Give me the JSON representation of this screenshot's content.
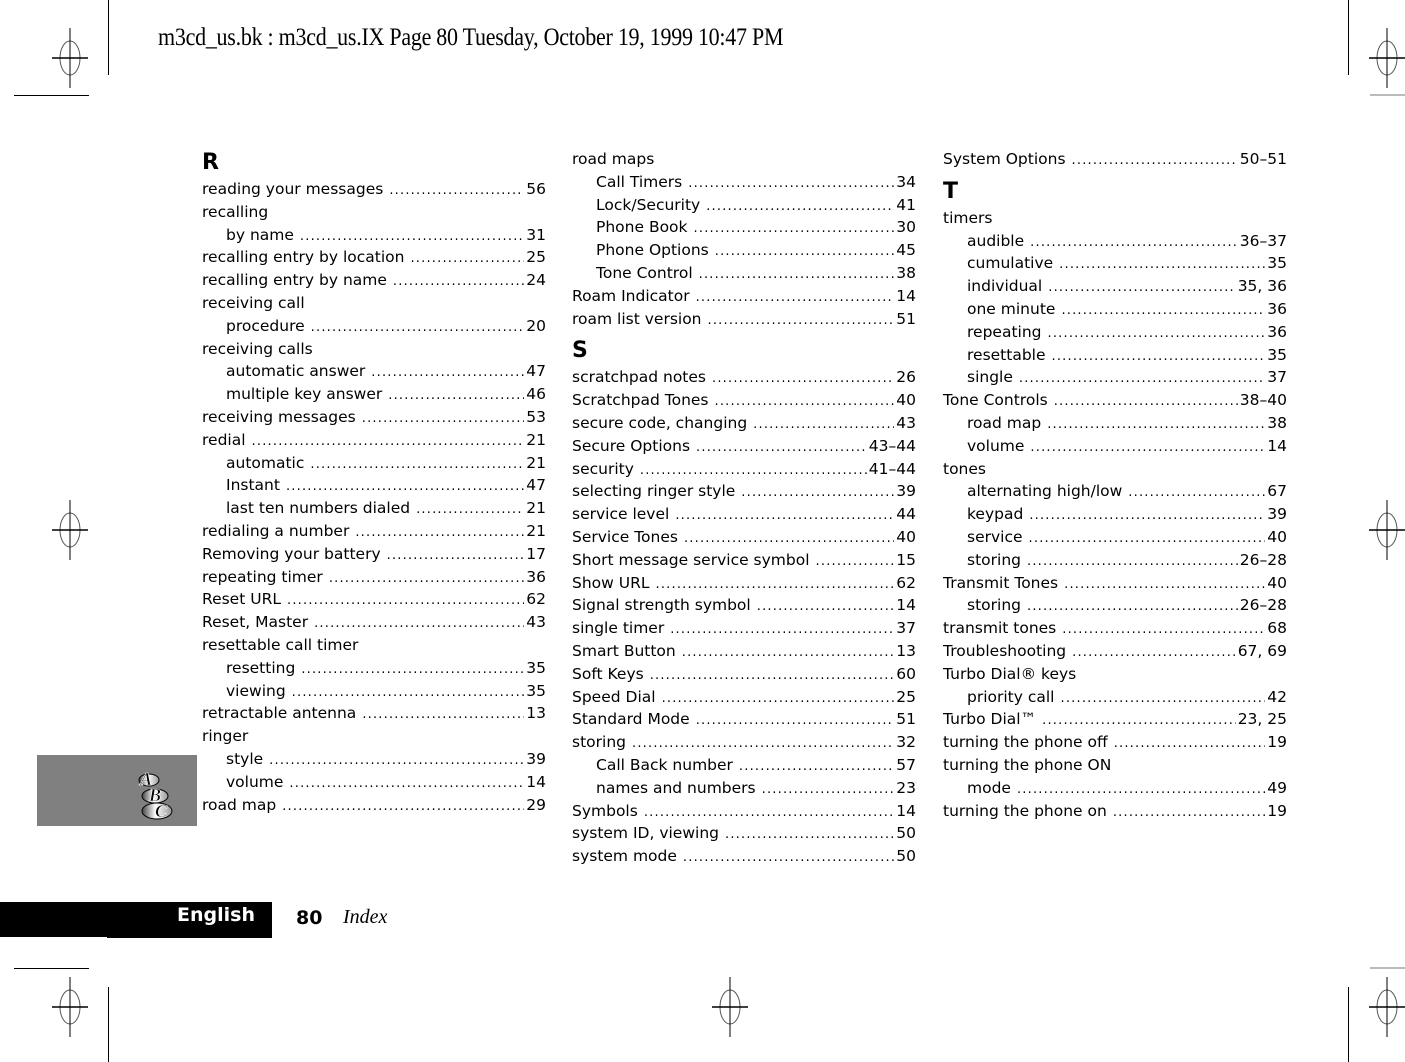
{
  "header": {
    "slug": "m3cd_us.bk : m3cd_us.IX  Page 80  Tuesday, October 19, 1999  10:47 PM"
  },
  "footer": {
    "language": "English",
    "page_number": "80",
    "section": "Index"
  },
  "tab_icon": "abc-index-icon",
  "columns": [
    [
      {
        "type": "letter",
        "text": "R"
      },
      {
        "type": "entry",
        "text": "reading your messages",
        "page": "56"
      },
      {
        "type": "entry",
        "text": "recalling",
        "page": ""
      },
      {
        "type": "sub",
        "text": "by name",
        "page": "31"
      },
      {
        "type": "entry",
        "text": "recalling entry by location",
        "page": "25"
      },
      {
        "type": "entry",
        "text": "recalling entry by name",
        "page": "24"
      },
      {
        "type": "entry",
        "text": "receiving call",
        "page": ""
      },
      {
        "type": "sub",
        "text": "procedure",
        "page": "20"
      },
      {
        "type": "entry",
        "text": "receiving calls",
        "page": ""
      },
      {
        "type": "sub",
        "text": "automatic answer",
        "page": "47"
      },
      {
        "type": "sub",
        "text": "multiple key answer",
        "page": "46"
      },
      {
        "type": "entry",
        "text": "receiving messages",
        "page": "53"
      },
      {
        "type": "entry",
        "text": "redial",
        "page": "21"
      },
      {
        "type": "sub",
        "text": "automatic",
        "page": "21"
      },
      {
        "type": "sub",
        "text": "Instant",
        "page": "47"
      },
      {
        "type": "sub",
        "text": "last ten numbers dialed",
        "page": "21"
      },
      {
        "type": "entry",
        "text": "redialing a number",
        "page": "21"
      },
      {
        "type": "entry",
        "text": "Removing your battery",
        "page": "17"
      },
      {
        "type": "entry",
        "text": "repeating timer",
        "page": "36"
      },
      {
        "type": "entry",
        "text": "Reset URL",
        "page": "62"
      },
      {
        "type": "entry",
        "text": "Reset, Master",
        "page": "43"
      },
      {
        "type": "entry",
        "text": "resettable call timer",
        "page": ""
      },
      {
        "type": "sub",
        "text": "resetting",
        "page": "35"
      },
      {
        "type": "sub",
        "text": "viewing",
        "page": "35"
      },
      {
        "type": "entry",
        "text": "retractable antenna",
        "page": "13"
      },
      {
        "type": "entry",
        "text": "ringer",
        "page": ""
      },
      {
        "type": "sub",
        "text": "style",
        "page": "39"
      },
      {
        "type": "sub",
        "text": "volume",
        "page": "14"
      },
      {
        "type": "entry",
        "text": "road map",
        "page": "29"
      }
    ],
    [
      {
        "type": "entry",
        "text": "road maps",
        "page": ""
      },
      {
        "type": "sub",
        "text": "Call Timers",
        "page": "34"
      },
      {
        "type": "sub",
        "text": "Lock/Security",
        "page": "41"
      },
      {
        "type": "sub",
        "text": "Phone Book",
        "page": "30"
      },
      {
        "type": "sub",
        "text": "Phone Options",
        "page": "45"
      },
      {
        "type": "sub",
        "text": "Tone Control",
        "page": "38"
      },
      {
        "type": "entry",
        "text": "Roam Indicator",
        "page": "14"
      },
      {
        "type": "entry",
        "text": "roam list version",
        "page": "51"
      },
      {
        "type": "letter",
        "text": "S"
      },
      {
        "type": "entry",
        "text": "scratchpad notes",
        "page": "26"
      },
      {
        "type": "entry",
        "text": "Scratchpad Tones",
        "page": "40"
      },
      {
        "type": "entry",
        "text": "secure code, changing",
        "page": "43"
      },
      {
        "type": "entry",
        "text": "Secure Options",
        "page": "43–44"
      },
      {
        "type": "entry",
        "text": "security",
        "page": "41–44"
      },
      {
        "type": "entry",
        "text": "selecting ringer style",
        "page": "39"
      },
      {
        "type": "entry",
        "text": "service level",
        "page": "44"
      },
      {
        "type": "entry",
        "text": "Service Tones",
        "page": "40"
      },
      {
        "type": "entry",
        "text": "Short message service symbol",
        "page": "15"
      },
      {
        "type": "entry",
        "text": "Show URL",
        "page": "62"
      },
      {
        "type": "entry",
        "text": "Signal strength symbol",
        "page": "14"
      },
      {
        "type": "entry",
        "text": "single timer",
        "page": "37"
      },
      {
        "type": "entry",
        "text": "Smart Button",
        "page": "13"
      },
      {
        "type": "entry",
        "text": "Soft Keys",
        "page": "60"
      },
      {
        "type": "entry",
        "text": "Speed Dial",
        "page": "25"
      },
      {
        "type": "entry",
        "text": "Standard Mode",
        "page": "51"
      },
      {
        "type": "entry",
        "text": "storing",
        "page": "32"
      },
      {
        "type": "sub",
        "text": "Call Back number",
        "page": "57"
      },
      {
        "type": "sub",
        "text": "names and numbers",
        "page": "23"
      },
      {
        "type": "entry",
        "text": "Symbols",
        "page": "14"
      },
      {
        "type": "entry",
        "text": "system ID, viewing",
        "page": "50"
      },
      {
        "type": "entry",
        "text": "system mode",
        "page": "50"
      }
    ],
    [
      {
        "type": "entry",
        "text": "System Options",
        "page": "50–51"
      },
      {
        "type": "letter",
        "text": "T"
      },
      {
        "type": "entry",
        "text": "timers",
        "page": ""
      },
      {
        "type": "sub",
        "text": "audible",
        "page": "36–37"
      },
      {
        "type": "sub",
        "text": "cumulative",
        "page": "35"
      },
      {
        "type": "sub",
        "text": "individual",
        "page": "35, 36"
      },
      {
        "type": "sub",
        "text": "one minute",
        "page": "36"
      },
      {
        "type": "sub",
        "text": "repeating",
        "page": "36"
      },
      {
        "type": "sub",
        "text": "resettable",
        "page": "35"
      },
      {
        "type": "sub",
        "text": "single",
        "page": "37"
      },
      {
        "type": "entry",
        "text": "Tone Controls",
        "page": "38–40"
      },
      {
        "type": "sub",
        "text": "road map",
        "page": "38"
      },
      {
        "type": "sub",
        "text": "volume",
        "page": "14"
      },
      {
        "type": "entry",
        "text": "tones",
        "page": ""
      },
      {
        "type": "sub",
        "text": "alternating high/low",
        "page": "67"
      },
      {
        "type": "sub",
        "text": "keypad",
        "page": "39"
      },
      {
        "type": "sub",
        "text": "service",
        "page": "40"
      },
      {
        "type": "sub",
        "text": "storing",
        "page": "26–28"
      },
      {
        "type": "entry",
        "text": "Transmit Tones",
        "page": "40"
      },
      {
        "type": "sub",
        "text": "storing",
        "page": "26–28"
      },
      {
        "type": "entry",
        "text": "transmit tones",
        "page": "68"
      },
      {
        "type": "entry",
        "text": "Troubleshooting",
        "page": "67, 69"
      },
      {
        "type": "entry",
        "text": "Turbo Dial® keys",
        "page": ""
      },
      {
        "type": "sub",
        "text": "priority call",
        "page": "42"
      },
      {
        "type": "entry",
        "text": "Turbo Dial™",
        "page": "23, 25"
      },
      {
        "type": "entry",
        "text": "turning the phone off",
        "page": "19"
      },
      {
        "type": "entry",
        "text": "turning the phone ON",
        "page": ""
      },
      {
        "type": "sub",
        "text": "mode",
        "page": "49"
      },
      {
        "type": "entry",
        "text": "turning the phone on",
        "page": "19"
      }
    ]
  ]
}
